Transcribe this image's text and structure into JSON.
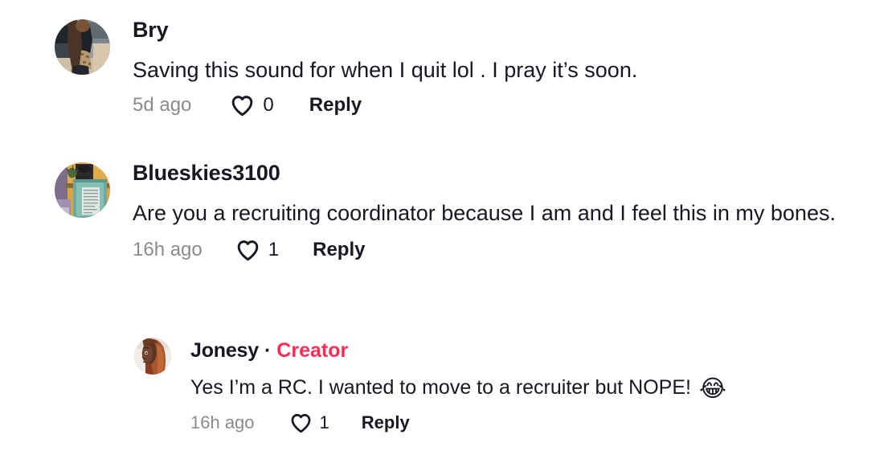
{
  "theme": {
    "background": "#ffffff",
    "text_primary": "#161823",
    "text_muted": "#8a8b91",
    "accent_creator": "#fe2c55"
  },
  "comments": [
    {
      "username": "Bry",
      "text": "Saving this sound for when I quit lol . I pray it’s soon.",
      "timestamp": "5d ago",
      "like_count": "0",
      "reply_label": "Reply",
      "heart_icon": "heart-outline-icon",
      "avatar_icon": "avatar-photo-bry",
      "is_creator": false,
      "creator_label": "",
      "separator": ""
    },
    {
      "username": "Blueskies3100",
      "text": "Are you a recruiting coordinator because I am and I feel this in my bones.",
      "timestamp": "16h ago",
      "like_count": "1",
      "reply_label": "Reply",
      "heart_icon": "heart-outline-icon",
      "avatar_icon": "avatar-photo-blueskies3100",
      "is_creator": false,
      "creator_label": "",
      "separator": ""
    },
    {
      "username": "Jonesy",
      "text": "Yes I’m a RC. I wanted to move to a recruiter but NOPE!",
      "emoji": "😂",
      "timestamp": "16h ago",
      "like_count": "1",
      "reply_label": "Reply",
      "heart_icon": "heart-outline-icon",
      "avatar_icon": "avatar-photo-jonesy",
      "is_creator": true,
      "creator_label": "Creator",
      "separator": "·"
    }
  ]
}
